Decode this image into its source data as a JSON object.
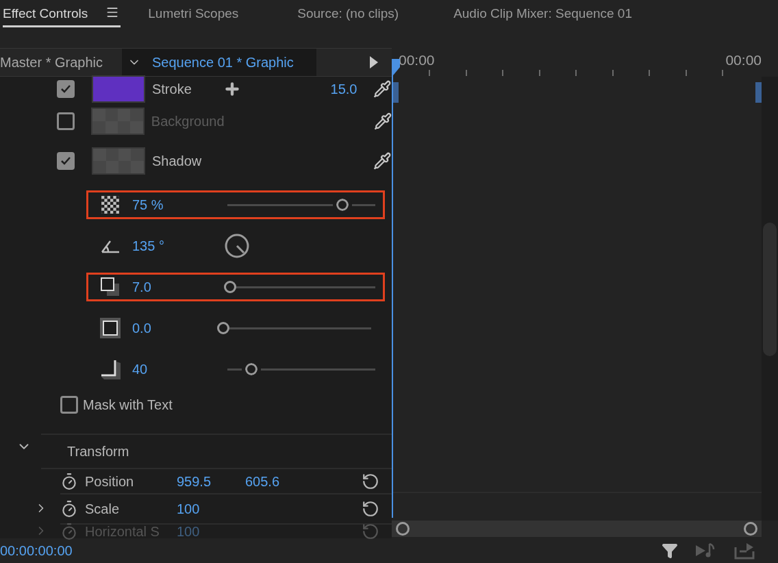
{
  "tabs": [
    {
      "label": "Effect Controls",
      "selected": true
    },
    {
      "label": "Lumetri Scopes",
      "selected": false
    },
    {
      "label": "Source: (no clips)",
      "selected": false
    },
    {
      "label": "Audio Clip Mixer: Sequence 01",
      "selected": false
    }
  ],
  "header": {
    "clip": "Master * Graphic",
    "sequence": "Sequence 01 * Graphic"
  },
  "ruler": {
    "start": "00:00",
    "end": "00:00"
  },
  "effects": [
    {
      "kind": "color",
      "label": "Stroke",
      "checked": true,
      "disabled": false,
      "color": "#5f30c0",
      "value": "15.0"
    },
    {
      "kind": "color",
      "label": "Background",
      "checked": false,
      "disabled": true
    },
    {
      "kind": "color",
      "label": "Shadow",
      "checked": true,
      "disabled": false
    },
    {
      "kind": "opacity",
      "value": "75 %",
      "level": 0.78,
      "highlighted": true
    },
    {
      "kind": "angle",
      "value": "135 °",
      "highlighted": false
    },
    {
      "kind": "distance",
      "value": "7.0",
      "level": 0.02,
      "highlighted": true
    },
    {
      "kind": "size",
      "value": "0.0",
      "level": 0,
      "highlighted": false
    },
    {
      "kind": "blur",
      "value": "40",
      "level": 0.16,
      "highlighted": false
    },
    {
      "kind": "checkbox",
      "label": "Mask with Text",
      "checked": false
    }
  ],
  "transform": {
    "label": "Transform",
    "expanded": true,
    "properties": [
      {
        "kind": "pair",
        "label": "Position",
        "values": [
          "959.5",
          "605.6"
        ],
        "disabled": false
      },
      {
        "kind": "scalar",
        "label": "Scale",
        "values": [
          "100"
        ],
        "disabled": false
      },
      {
        "kind": "scalar",
        "label": "Horizontal S",
        "values": [
          "100"
        ],
        "disabled": true
      }
    ]
  },
  "footer": {
    "timecode": "00:00:00:00"
  }
}
